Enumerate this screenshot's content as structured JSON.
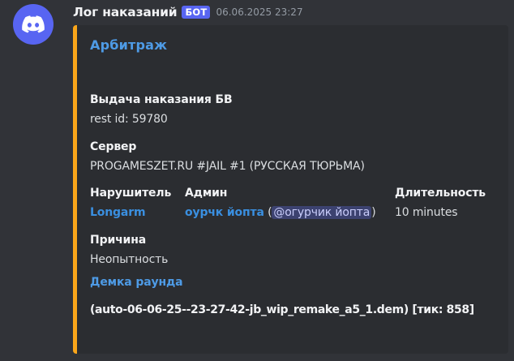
{
  "message": {
    "avatar_icon": "discord-logo-icon",
    "username": "Лог наказаний",
    "badge": "БОТ",
    "timestamp": "06.06.2025 23:27"
  },
  "embed": {
    "accent_color": "#faa61a",
    "title": "Арбитраж",
    "description_title": "Выдача наказания БВ",
    "description_value": "rest id: 59780",
    "server_label": "Сервер",
    "server_value": "PROGAMESZET.RU #JAIL #1 (РУССКАЯ ТЮРЬМА)",
    "offender_label": "Нарушитель",
    "offender_value": "Longarm",
    "admin_label": "Админ",
    "admin_name": "оурчк йопта",
    "admin_open_paren": "(",
    "admin_mention": "@огурчик йопта",
    "admin_close_paren": ")",
    "duration_label": "Длительность",
    "duration_value": "10 minutes",
    "reason_label": "Причина",
    "reason_value": "Неопытность",
    "demo_label": "Демка раунда",
    "demo_value": "(auto-06-06-25--23-27-42-jb_wip_remake_a5_1.dem) [тик: 858]"
  }
}
